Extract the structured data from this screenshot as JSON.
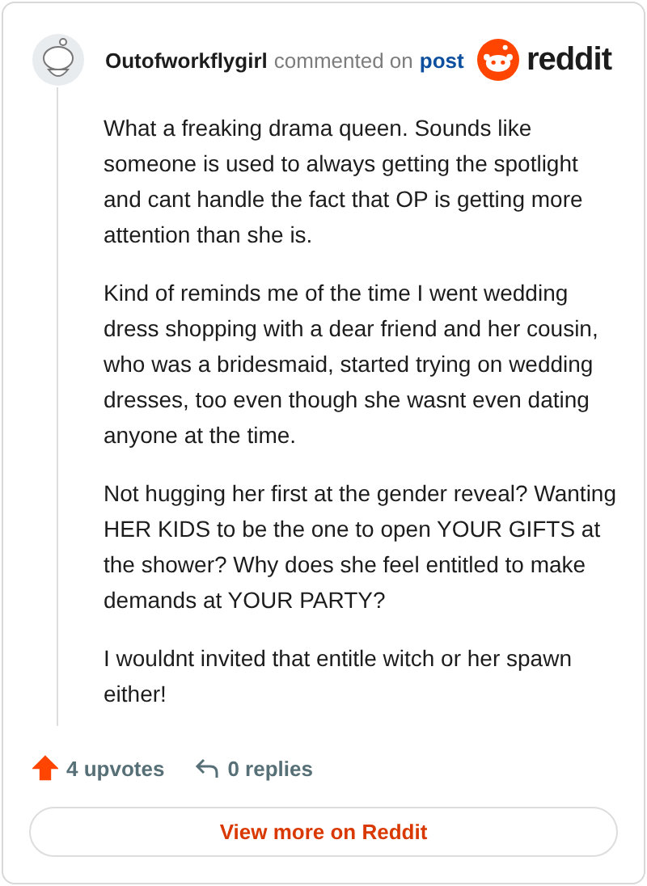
{
  "header": {
    "username": "Outofworkflygirl",
    "action": "commented on",
    "post_link": "post",
    "logo_text": "reddit"
  },
  "comment": {
    "paragraphs": [
      "What a freaking drama queen. Sounds like someone is used to always getting the spotlight and cant handle the fact that OP is getting more attention than she is.",
      "Kind of reminds me of the time I went wedding dress shopping with a dear friend and her cousin, who was a bridesmaid, started trying on wedding dresses, too even though she wasnt even dating anyone at the time.",
      "Not hugging her first at the gender reveal? Wanting HER KIDS to be the one to open YOUR GIFTS at the shower? Why does she feel entitled to make demands at YOUR PARTY?",
      "I wouldnt invited that entitle witch or her spawn either!"
    ]
  },
  "footer": {
    "upvotes": "4 upvotes",
    "upvoted": true,
    "replies": "0 replies",
    "button": "View more on Reddit"
  }
}
